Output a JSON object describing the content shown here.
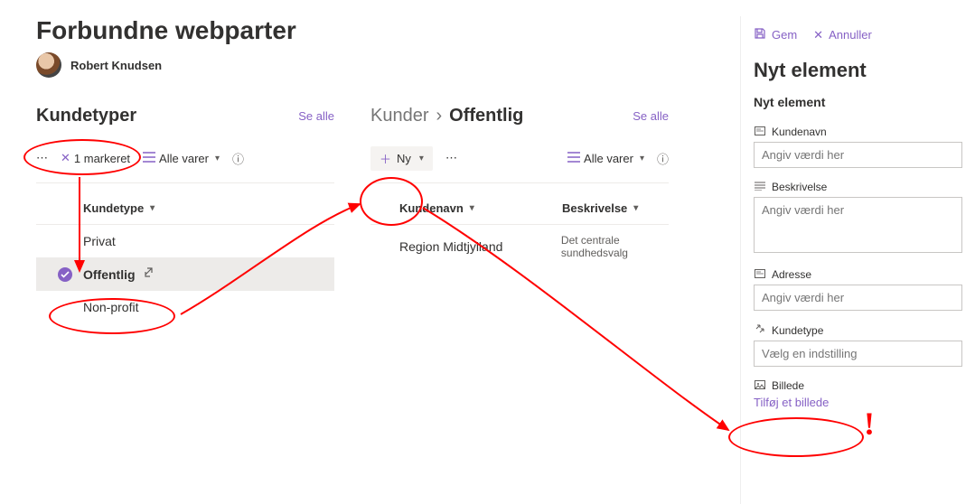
{
  "page": {
    "title": "Forbundne webparter",
    "author": "Robert Knudsen"
  },
  "left": {
    "title": "Kundetyper",
    "see_all": "Se alle",
    "toolbar": {
      "selected_text": "1 markeret",
      "view_label": "Alle varer"
    },
    "column_header": "Kundetype",
    "rows": [
      "Privat",
      "Offentlig",
      "Non-profit"
    ]
  },
  "right_list": {
    "breadcrumb_root": "Kunder",
    "breadcrumb_current": "Offentlig",
    "see_all": "Se alle",
    "new_label": "Ny",
    "view_label": "Alle varer",
    "col1": "Kundenavn",
    "col2": "Beskrivelse",
    "row1_name": "Region Midtjylland",
    "row1_desc": "Det centrale sundhedsvalg"
  },
  "panel": {
    "save": "Gem",
    "cancel": "Annuller",
    "title": "Nyt element",
    "subtitle": "Nyt element",
    "placeholder_text": "Angiv værdi her",
    "select_placeholder": "Vælg en indstilling",
    "fields": {
      "kundenavn": "Kundenavn",
      "beskrivelse": "Beskrivelse",
      "adresse": "Adresse",
      "kundetype": "Kundetype",
      "billede": "Billede"
    },
    "add_image": "Tilføj et billede"
  }
}
